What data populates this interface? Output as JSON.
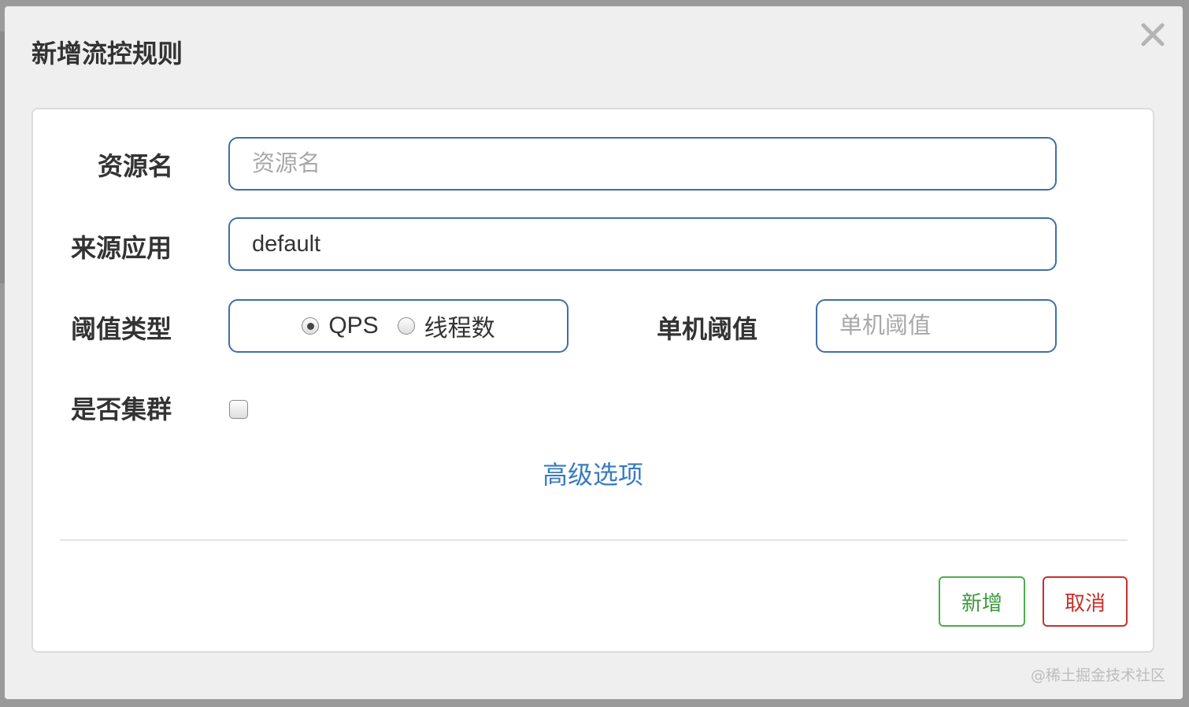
{
  "dialog": {
    "title": "新增流控规则",
    "close_icon": "close-icon"
  },
  "form": {
    "resource_name": {
      "label": "资源名",
      "placeholder": "资源名",
      "value": ""
    },
    "source_app": {
      "label": "来源应用",
      "value": "default"
    },
    "threshold_type": {
      "label": "阈值类型",
      "options": [
        {
          "label": "QPS",
          "checked": true
        },
        {
          "label": "线程数",
          "checked": false
        }
      ]
    },
    "single_threshold": {
      "label": "单机阈值",
      "placeholder": "单机阈值",
      "value": ""
    },
    "cluster": {
      "label": "是否集群",
      "checked": false
    },
    "advanced_link": "高级选项"
  },
  "footer": {
    "add_label": "新增",
    "cancel_label": "取消"
  },
  "colors": {
    "input_border": "#3f6fa6",
    "link": "#3a7bbf",
    "add_button": "#4cae4c",
    "cancel_button": "#c9302c"
  },
  "watermark": "@稀土掘金技术社区"
}
